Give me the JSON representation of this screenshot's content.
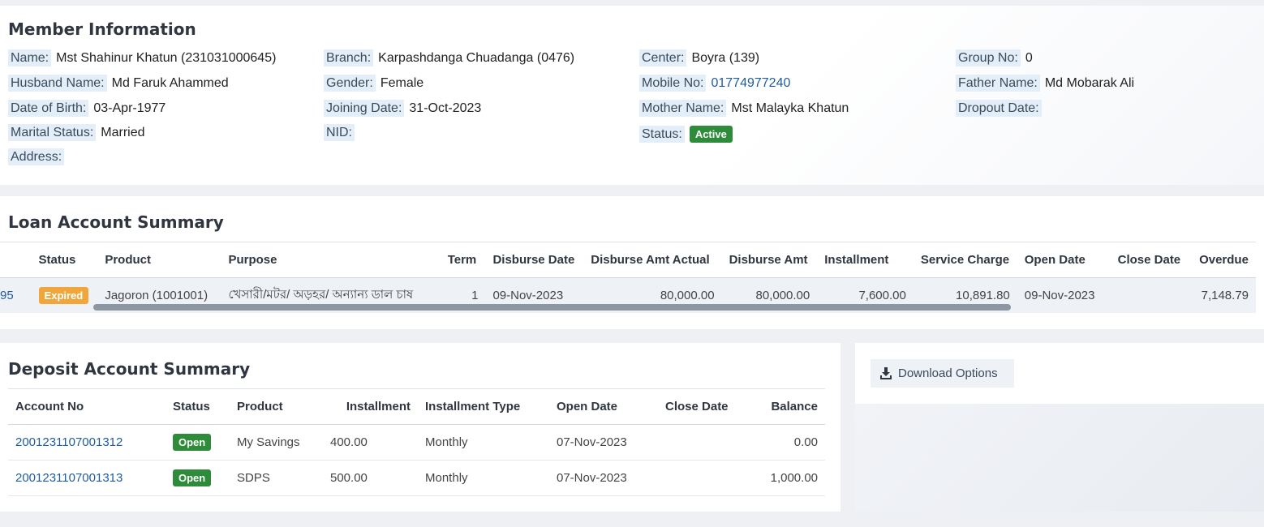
{
  "member": {
    "title": "Member Information",
    "col1": [
      {
        "label": "Name:",
        "value": "Mst Shahinur Khatun (231031000645)"
      },
      {
        "label": "Husband Name:",
        "value": "Md Faruk Ahammed"
      },
      {
        "label": "Date of Birth:",
        "value": "03-Apr-1977"
      },
      {
        "label": "Marital Status:",
        "value": "Married"
      },
      {
        "label": "Address:",
        "value": ""
      }
    ],
    "col2": [
      {
        "label": "Branch:",
        "value": "Karpashdanga Chuadanga (0476)"
      },
      {
        "label": "Gender:",
        "value": "Female"
      },
      {
        "label": "Joining Date:",
        "value": "31-Oct-2023"
      },
      {
        "label": "NID:",
        "value": ""
      }
    ],
    "col3": [
      {
        "label": "Center:",
        "value": "Boyra (139)"
      },
      {
        "label": "Mobile No:",
        "value": "01774977240"
      },
      {
        "label": "Mother Name:",
        "value": "Mst Malayka Khatun"
      },
      {
        "label": "Status:",
        "value": "Active"
      }
    ],
    "col4": [
      {
        "label": "Group No:",
        "value": "0"
      },
      {
        "label": "Father Name:",
        "value": "Md Mobarak Ali"
      },
      {
        "label": "Dropout Date:",
        "value": ""
      }
    ]
  },
  "loan": {
    "title": "Loan Account Summary",
    "headers": [
      "",
      "Status",
      "Product",
      "Purpose",
      "Term",
      "Disburse Date",
      "Disburse Amt Actual",
      "Disburse Amt",
      "Installment",
      "Service Charge",
      "Open Date",
      "Close Date",
      "Overdue"
    ],
    "row": {
      "account": "95",
      "status": "Expired",
      "product": "Jagoron (1001001)",
      "purpose": "খেসারী/মটর/ অড়হর/ অন্যান্য ডাল চাষ",
      "term": "1",
      "disburse_date": "09-Nov-2023",
      "disburse_amt_actual": "80,000.00",
      "disburse_amt": "80,000.00",
      "installment": "7,600.00",
      "service_charge": "10,891.80",
      "open_date": "09-Nov-2023",
      "close_date": "",
      "overdue": "7,148.79"
    }
  },
  "deposit": {
    "title": "Deposit Account Summary",
    "headers": [
      "Account No",
      "Status",
      "Product",
      "Installment",
      "Installment Type",
      "Open Date",
      "Close Date",
      "Balance"
    ],
    "rows": [
      {
        "account_no": "2001231107001312",
        "status": "Open",
        "product": "My Savings",
        "installment": "400.00",
        "installment_type": "Monthly",
        "open_date": "07-Nov-2023",
        "close_date": "",
        "balance": "0.00"
      },
      {
        "account_no": "2001231107001313",
        "status": "Open",
        "product": "SDPS",
        "installment": "500.00",
        "installment_type": "Monthly",
        "open_date": "07-Nov-2023",
        "close_date": "",
        "balance": "1,000.00"
      }
    ]
  },
  "download": {
    "label": "Download Options",
    "icon": "download-icon"
  },
  "colors": {
    "link": "#1f5c9e",
    "active_badge": "#2e8b3a",
    "expired_badge": "#f0a63a",
    "label_bg": "#e3eef8"
  }
}
